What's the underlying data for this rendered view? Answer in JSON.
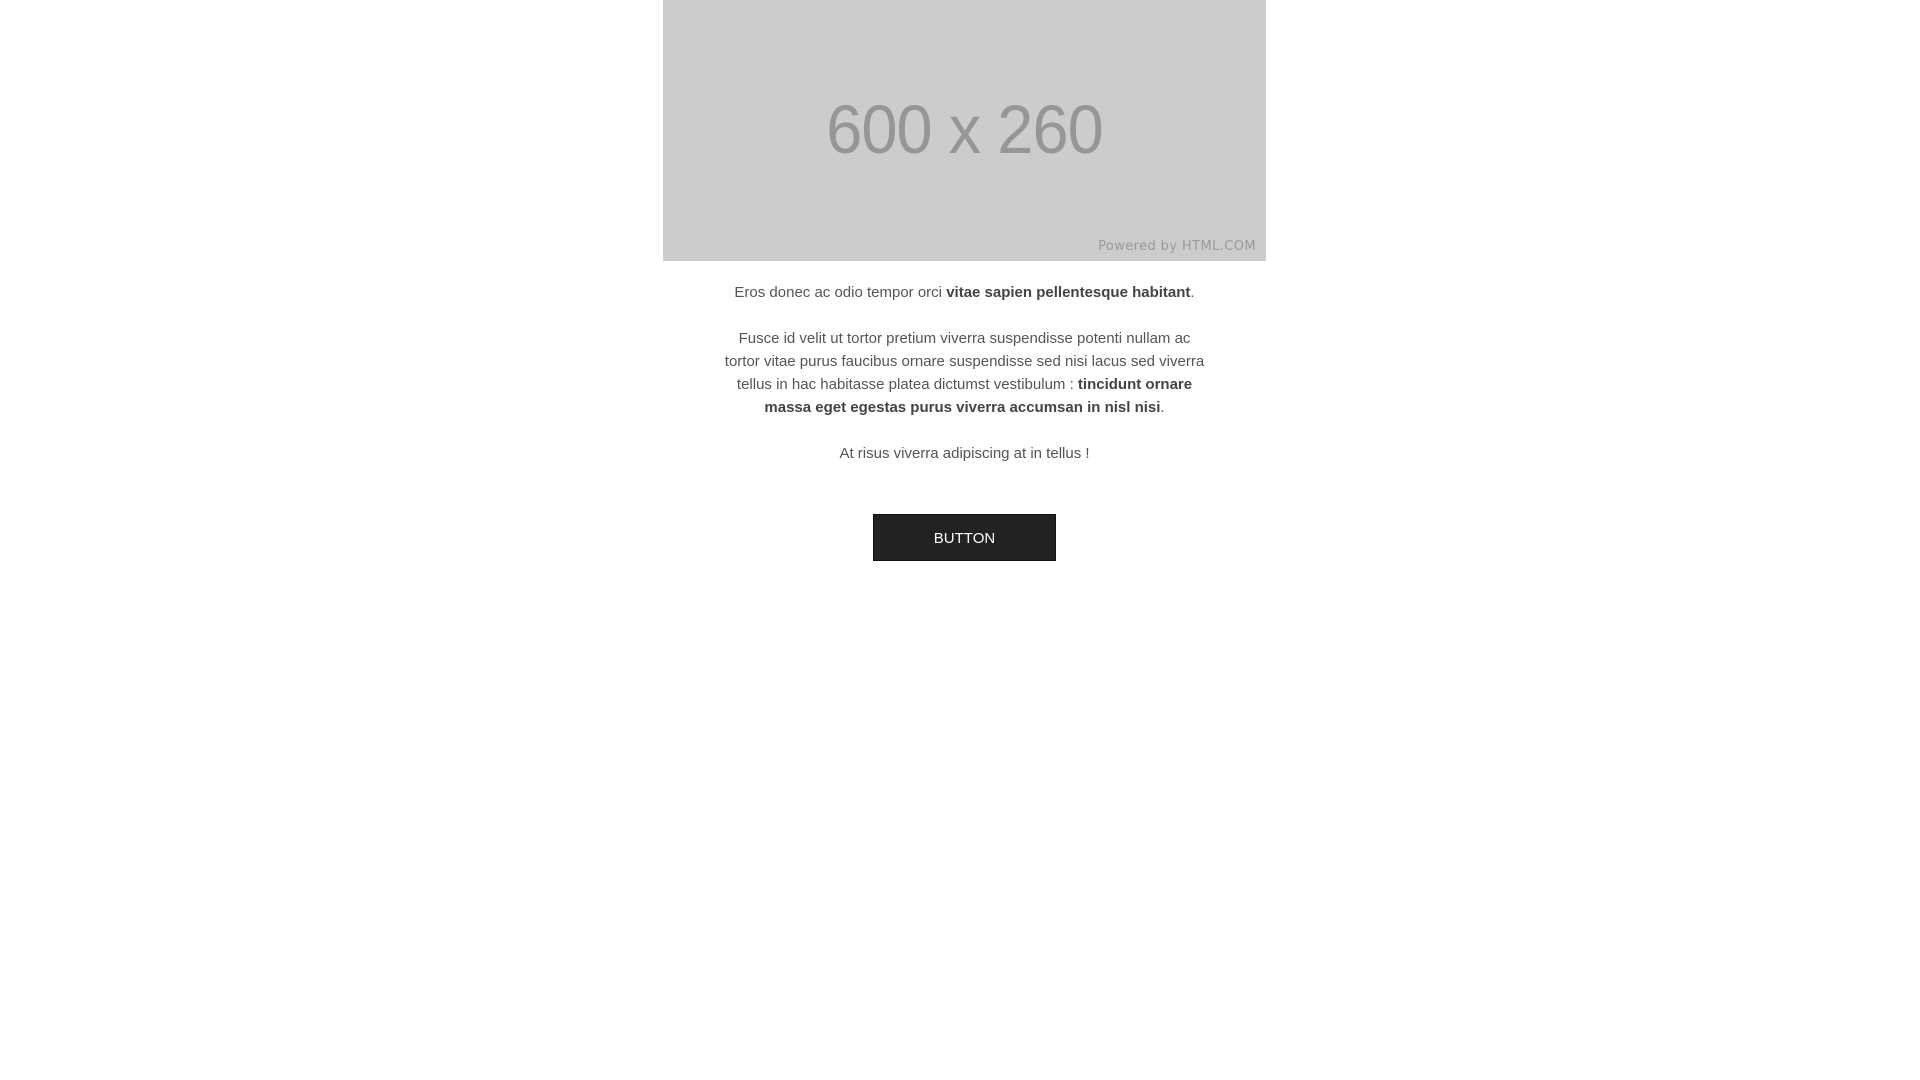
{
  "hero": {
    "dimensions_label": "600 x 260",
    "powered_by": "Powered by HTML.COM",
    "background_color": "#cccccc"
  },
  "content": {
    "paragraph1": {
      "text": "Eros donec ac odio tempor orci ",
      "bold": "vitae sapien pellentesque habitant",
      "end": "."
    },
    "paragraph2": {
      "text": "Fusce id velit ut tortor pretium viverra suspendisse potenti nullam ac tortor vitae purus faucibus ornare suspendisse sed nisi lacus sed viverra tellus in hac habitasse platea dictumst vestibulum : ",
      "bold": "tincidunt ornare massa eget egestas purus viverra accumsan in nisl nisi",
      "end": "."
    },
    "paragraph3": {
      "text": "At risus viverra adipiscing at in tellus !"
    }
  },
  "cta": {
    "label": "BUTTON",
    "background_color": "#222222"
  }
}
